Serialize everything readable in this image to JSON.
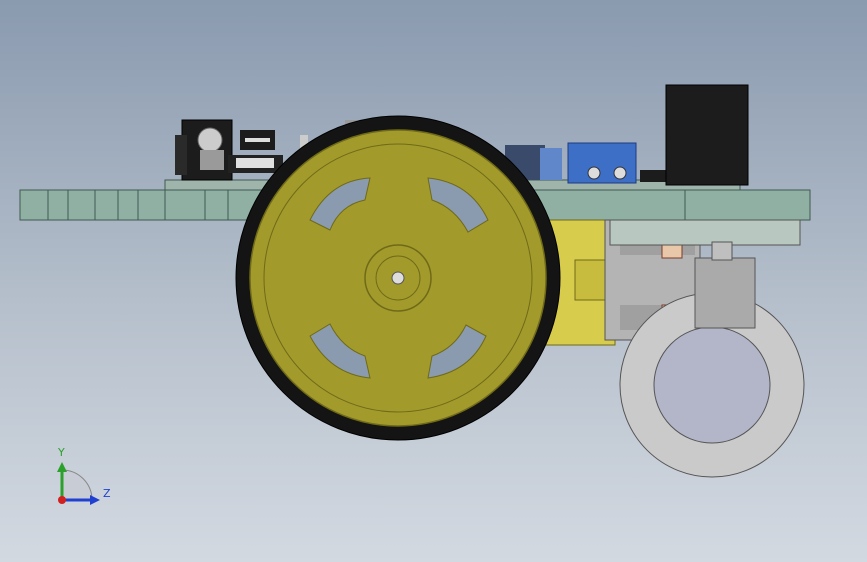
{
  "viewport": {
    "background_top": "#8a9aaf",
    "background_bottom": "#d3d9e1"
  },
  "model": {
    "colors": {
      "chassis": "#8fb0a3",
      "chassis_edge": "#3f5a50",
      "wheel_hub": "#a39a2c",
      "wheel_hub_dark": "#6f6a18",
      "tire": "#141414",
      "motor_yellow": "#d8cc4c",
      "motor_gray": "#b4b4b4",
      "caster_gray": "#aaaaaa",
      "terminal_blue": "#3d6fc7",
      "battery_black": "#1c1c1c"
    }
  },
  "triad": {
    "y_label": "Y",
    "z_label": "Z",
    "y_color": "#2ba02b",
    "z_color": "#2040d0",
    "x_color": "#d02020"
  }
}
